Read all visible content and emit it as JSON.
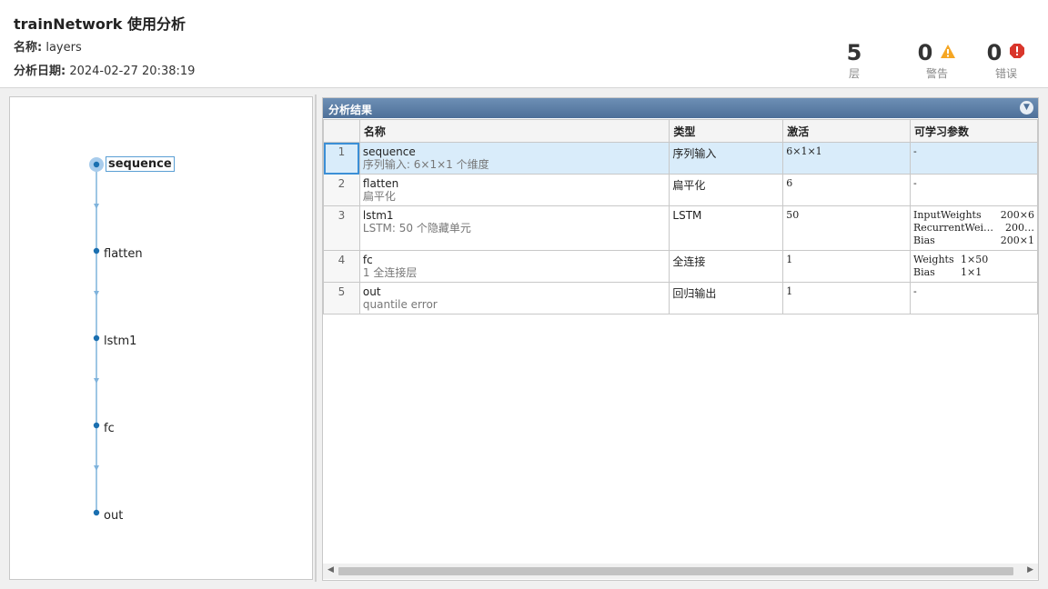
{
  "header": {
    "title": "trainNetwork 使用分析",
    "name_label": "名称:",
    "name_value": "layers",
    "date_label": "分析日期:",
    "date_value": "2024-02-27 20:38:19",
    "stats": [
      {
        "value": "5",
        "label": "层"
      },
      {
        "value": "0",
        "label": "警告",
        "icon": "warning-icon",
        "color": "#f5a623"
      },
      {
        "value": "0",
        "label": "错误",
        "icon": "error-icon",
        "color": "#d9362b"
      }
    ]
  },
  "graph": {
    "nodes": [
      "sequence",
      "flatten",
      "lstm1",
      "fc",
      "out"
    ],
    "selected": "sequence",
    "accent": "#1a6fb0"
  },
  "results": {
    "title": "分析结果",
    "columns": [
      "",
      "名称",
      "类型",
      "激活",
      "可学习参数"
    ],
    "rows": [
      {
        "idx": "1",
        "name": "sequence",
        "desc": "序列输入: 6×1×1 个维度",
        "type": "序列输入",
        "act": "6×1×1",
        "params": [
          [
            "-",
            ""
          ]
        ]
      },
      {
        "idx": "2",
        "name": "flatten",
        "desc": "扁平化",
        "type": "扁平化",
        "act": "6",
        "params": [
          [
            "-",
            ""
          ]
        ]
      },
      {
        "idx": "3",
        "name": "lstm1",
        "desc": "LSTM: 50 个隐藏单元",
        "type": "LSTM",
        "act": "50",
        "params": [
          [
            "InputWeights",
            "200×6"
          ],
          [
            "RecurrentWei…",
            "200…"
          ],
          [
            "Bias",
            "200×1"
          ]
        ]
      },
      {
        "idx": "4",
        "name": "fc",
        "desc": "1 全连接层",
        "type": "全连接",
        "act": "1",
        "params": [
          [
            "Weights",
            "1×50"
          ],
          [
            "Bias",
            "1×1"
          ]
        ]
      },
      {
        "idx": "5",
        "name": "out",
        "desc": "quantile error",
        "type": "回归输出",
        "act": "1",
        "params": [
          [
            "-",
            ""
          ]
        ]
      }
    ]
  }
}
